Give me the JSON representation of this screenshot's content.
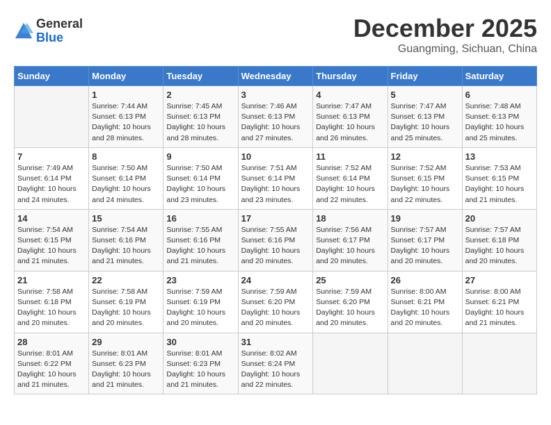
{
  "logo": {
    "general": "General",
    "blue": "Blue"
  },
  "title": {
    "month": "December 2025",
    "location": "Guangming, Sichuan, China"
  },
  "headers": [
    "Sunday",
    "Monday",
    "Tuesday",
    "Wednesday",
    "Thursday",
    "Friday",
    "Saturday"
  ],
  "weeks": [
    [
      {
        "day": "",
        "sunrise": "",
        "sunset": "",
        "daylight": ""
      },
      {
        "day": "1",
        "sunrise": "Sunrise: 7:44 AM",
        "sunset": "Sunset: 6:13 PM",
        "daylight": "Daylight: 10 hours and 28 minutes."
      },
      {
        "day": "2",
        "sunrise": "Sunrise: 7:45 AM",
        "sunset": "Sunset: 6:13 PM",
        "daylight": "Daylight: 10 hours and 28 minutes."
      },
      {
        "day": "3",
        "sunrise": "Sunrise: 7:46 AM",
        "sunset": "Sunset: 6:13 PM",
        "daylight": "Daylight: 10 hours and 27 minutes."
      },
      {
        "day": "4",
        "sunrise": "Sunrise: 7:47 AM",
        "sunset": "Sunset: 6:13 PM",
        "daylight": "Daylight: 10 hours and 26 minutes."
      },
      {
        "day": "5",
        "sunrise": "Sunrise: 7:47 AM",
        "sunset": "Sunset: 6:13 PM",
        "daylight": "Daylight: 10 hours and 25 minutes."
      },
      {
        "day": "6",
        "sunrise": "Sunrise: 7:48 AM",
        "sunset": "Sunset: 6:13 PM",
        "daylight": "Daylight: 10 hours and 25 minutes."
      }
    ],
    [
      {
        "day": "7",
        "sunrise": "Sunrise: 7:49 AM",
        "sunset": "Sunset: 6:14 PM",
        "daylight": "Daylight: 10 hours and 24 minutes."
      },
      {
        "day": "8",
        "sunrise": "Sunrise: 7:50 AM",
        "sunset": "Sunset: 6:14 PM",
        "daylight": "Daylight: 10 hours and 24 minutes."
      },
      {
        "day": "9",
        "sunrise": "Sunrise: 7:50 AM",
        "sunset": "Sunset: 6:14 PM",
        "daylight": "Daylight: 10 hours and 23 minutes."
      },
      {
        "day": "10",
        "sunrise": "Sunrise: 7:51 AM",
        "sunset": "Sunset: 6:14 PM",
        "daylight": "Daylight: 10 hours and 23 minutes."
      },
      {
        "day": "11",
        "sunrise": "Sunrise: 7:52 AM",
        "sunset": "Sunset: 6:14 PM",
        "daylight": "Daylight: 10 hours and 22 minutes."
      },
      {
        "day": "12",
        "sunrise": "Sunrise: 7:52 AM",
        "sunset": "Sunset: 6:15 PM",
        "daylight": "Daylight: 10 hours and 22 minutes."
      },
      {
        "day": "13",
        "sunrise": "Sunrise: 7:53 AM",
        "sunset": "Sunset: 6:15 PM",
        "daylight": "Daylight: 10 hours and 21 minutes."
      }
    ],
    [
      {
        "day": "14",
        "sunrise": "Sunrise: 7:54 AM",
        "sunset": "Sunset: 6:15 PM",
        "daylight": "Daylight: 10 hours and 21 minutes."
      },
      {
        "day": "15",
        "sunrise": "Sunrise: 7:54 AM",
        "sunset": "Sunset: 6:16 PM",
        "daylight": "Daylight: 10 hours and 21 minutes."
      },
      {
        "day": "16",
        "sunrise": "Sunrise: 7:55 AM",
        "sunset": "Sunset: 6:16 PM",
        "daylight": "Daylight: 10 hours and 21 minutes."
      },
      {
        "day": "17",
        "sunrise": "Sunrise: 7:55 AM",
        "sunset": "Sunset: 6:16 PM",
        "daylight": "Daylight: 10 hours and 20 minutes."
      },
      {
        "day": "18",
        "sunrise": "Sunrise: 7:56 AM",
        "sunset": "Sunset: 6:17 PM",
        "daylight": "Daylight: 10 hours and 20 minutes."
      },
      {
        "day": "19",
        "sunrise": "Sunrise: 7:57 AM",
        "sunset": "Sunset: 6:17 PM",
        "daylight": "Daylight: 10 hours and 20 minutes."
      },
      {
        "day": "20",
        "sunrise": "Sunrise: 7:57 AM",
        "sunset": "Sunset: 6:18 PM",
        "daylight": "Daylight: 10 hours and 20 minutes."
      }
    ],
    [
      {
        "day": "21",
        "sunrise": "Sunrise: 7:58 AM",
        "sunset": "Sunset: 6:18 PM",
        "daylight": "Daylight: 10 hours and 20 minutes."
      },
      {
        "day": "22",
        "sunrise": "Sunrise: 7:58 AM",
        "sunset": "Sunset: 6:19 PM",
        "daylight": "Daylight: 10 hours and 20 minutes."
      },
      {
        "day": "23",
        "sunrise": "Sunrise: 7:59 AM",
        "sunset": "Sunset: 6:19 PM",
        "daylight": "Daylight: 10 hours and 20 minutes."
      },
      {
        "day": "24",
        "sunrise": "Sunrise: 7:59 AM",
        "sunset": "Sunset: 6:20 PM",
        "daylight": "Daylight: 10 hours and 20 minutes."
      },
      {
        "day": "25",
        "sunrise": "Sunrise: 7:59 AM",
        "sunset": "Sunset: 6:20 PM",
        "daylight": "Daylight: 10 hours and 20 minutes."
      },
      {
        "day": "26",
        "sunrise": "Sunrise: 8:00 AM",
        "sunset": "Sunset: 6:21 PM",
        "daylight": "Daylight: 10 hours and 20 minutes."
      },
      {
        "day": "27",
        "sunrise": "Sunrise: 8:00 AM",
        "sunset": "Sunset: 6:21 PM",
        "daylight": "Daylight: 10 hours and 21 minutes."
      }
    ],
    [
      {
        "day": "28",
        "sunrise": "Sunrise: 8:01 AM",
        "sunset": "Sunset: 6:22 PM",
        "daylight": "Daylight: 10 hours and 21 minutes."
      },
      {
        "day": "29",
        "sunrise": "Sunrise: 8:01 AM",
        "sunset": "Sunset: 6:23 PM",
        "daylight": "Daylight: 10 hours and 21 minutes."
      },
      {
        "day": "30",
        "sunrise": "Sunrise: 8:01 AM",
        "sunset": "Sunset: 6:23 PM",
        "daylight": "Daylight: 10 hours and 21 minutes."
      },
      {
        "day": "31",
        "sunrise": "Sunrise: 8:02 AM",
        "sunset": "Sunset: 6:24 PM",
        "daylight": "Daylight: 10 hours and 22 minutes."
      },
      {
        "day": "",
        "sunrise": "",
        "sunset": "",
        "daylight": ""
      },
      {
        "day": "",
        "sunrise": "",
        "sunset": "",
        "daylight": ""
      },
      {
        "day": "",
        "sunrise": "",
        "sunset": "",
        "daylight": ""
      }
    ]
  ]
}
